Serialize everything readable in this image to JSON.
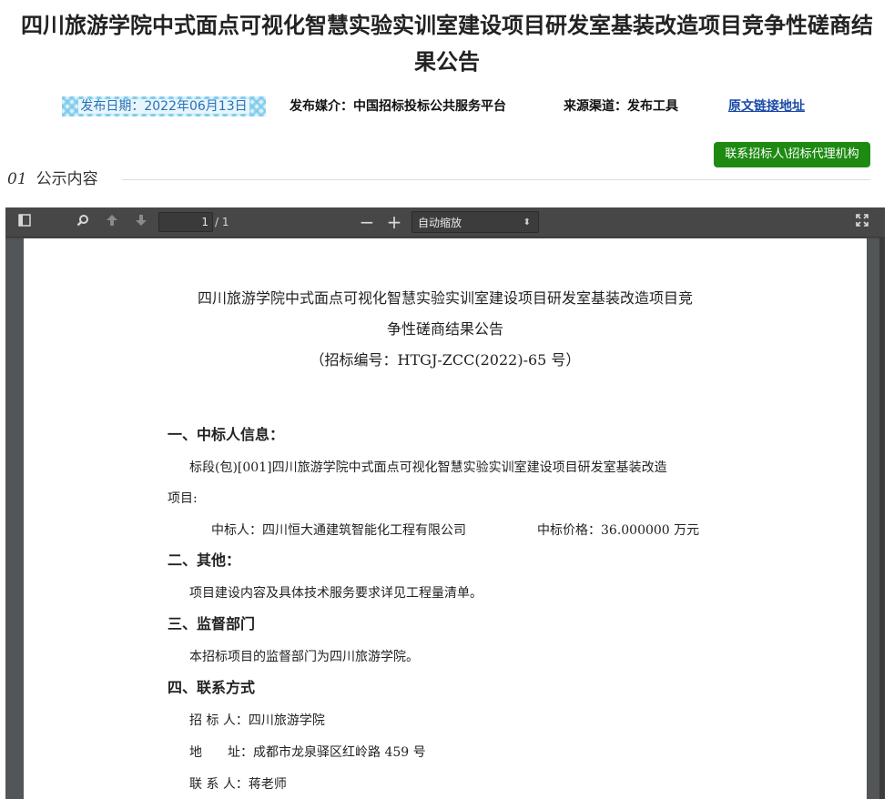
{
  "header": {
    "title_line1": "四川旅游学院中式面点可视化智慧实验实训室建设项目研发室基装改造项目竞争性磋商结",
    "title_line2": "果公告",
    "publish_date": "发布日期：2022年06月13日",
    "media": "发布媒介：中国招标投标公共服务平台",
    "source": "来源渠道：发布工具",
    "original_link": "原文链接地址"
  },
  "contact_button": "联系招标人\\招标代理机构",
  "section": {
    "number": "01",
    "label": "公示内容"
  },
  "viewer": {
    "current_page": "1",
    "page_total": "/ 1",
    "zoom": "自动缩放",
    "icons": [
      "sidebar-toggle-icon",
      "search-icon",
      "arrow-up-icon",
      "arrow-down-icon",
      "zoom-out-icon",
      "zoom-in-icon",
      "fullscreen-icon"
    ]
  },
  "document": {
    "title_line1": "四川旅游学院中式面点可视化智慧实验实训室建设项目研发室基装改造项目竞",
    "title_line2": "争性磋商结果公告",
    "code": "（招标编号：HTGJ-ZCC(2022)-65 号）",
    "s1_heading": "一、中标人信息：",
    "s1_lot_line1": "标段(包)[001]四川旅游学院中式面点可视化智慧实验实训室建设项目研发室基装改造",
    "s1_lot_line2": "项目:",
    "s1_winner": "中标人：四川恒大通建筑智能化工程有限公司",
    "s1_price": "中标价格：36.000000 万元",
    "s2_heading": "二、其他：",
    "s2_text": "项目建设内容及具体技术服务要求详见工程量清单。",
    "s3_heading": "三、监督部门",
    "s3_text": "本招标项目的监督部门为四川旅游学院。",
    "s4_heading": "四、联系方式",
    "s4_tenderer": "招 标 人：四川旅游学院",
    "s4_address": "地　　址：成都市龙泉驿区红岭路 459 号",
    "s4_contact": "联 系 人：蒋老师"
  }
}
